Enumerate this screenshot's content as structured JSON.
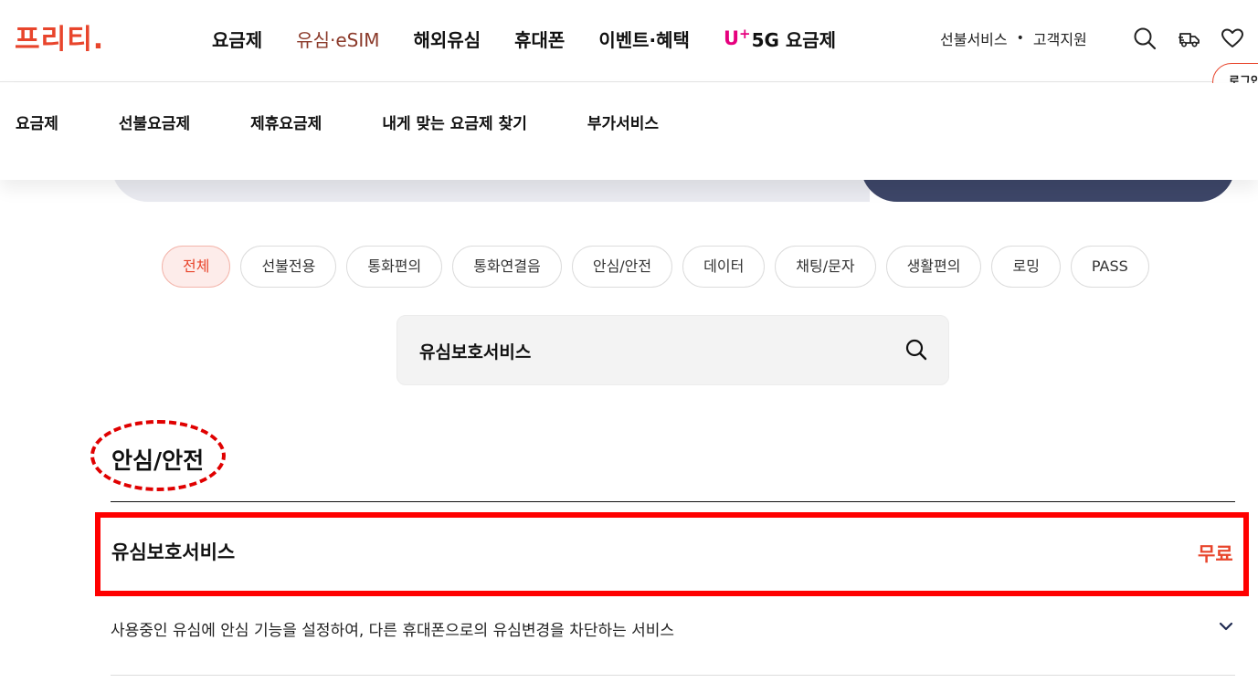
{
  "header": {
    "logo": "프리티.",
    "nav": [
      "요금제",
      "유심·eSIM",
      "해외유심",
      "휴대폰",
      "이벤트·혜택"
    ],
    "uplus_prefix": "U",
    "uplus_plus": "+",
    "uplus_label": "5G 요금제",
    "util_prepaid": "선불서비스",
    "util_sep": "•",
    "util_support": "고객지원",
    "login_label": "로그인"
  },
  "subnav": [
    "요금제",
    "선불요금제",
    "제휴요금제",
    "내게 맞는 요금제 찾기",
    "부가서비스"
  ],
  "filters": [
    "전체",
    "선불전용",
    "통화편의",
    "통화연결음",
    "안심/안전",
    "데이터",
    "채팅/문자",
    "생활편의",
    "로밍",
    "PASS"
  ],
  "search": {
    "value": "유심보호서비스"
  },
  "result": {
    "category": "안심/안전",
    "item_name": "유심보호서비스",
    "item_price": "무료",
    "item_desc": "사용중인 유심에 안심 기능을 설정하여, 다른 휴대폰으로의 유심변경을 차단하는 서비스"
  },
  "colors": {
    "brand": "#e8452c",
    "highlight": "#ff0000",
    "uplus": "#e6007e",
    "banner_dark": "#3d4668"
  },
  "icons": [
    "search-icon",
    "delivery-truck-icon",
    "heart-icon",
    "chevron-down-icon"
  ]
}
